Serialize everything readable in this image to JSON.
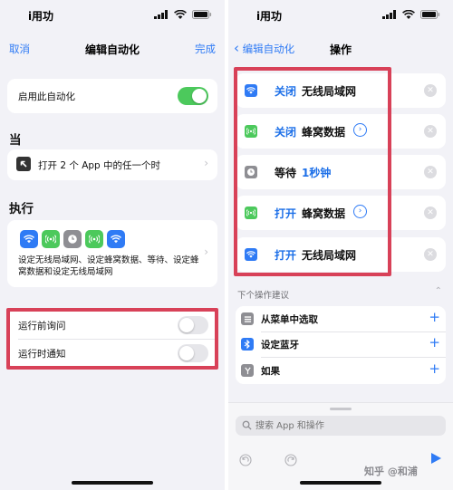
{
  "colors": {
    "accent": "#2f7bf5",
    "toggle_on": "#4cc95c",
    "highlight": "#d84158",
    "wifi_icon": "#2f7bf5",
    "cellular_icon": "#4cc95c",
    "wait_icon": "#8e8e93"
  },
  "left": {
    "status": {
      "carrier": "i用功"
    },
    "nav": {
      "cancel": "取消",
      "title": "编辑自动化",
      "done": "完成"
    },
    "enable_label": "启用此自动化",
    "enable_on": true,
    "when": {
      "title": "当",
      "trigger_text": "打开 2 个 App 中的任一个时",
      "trigger_icon": "arrow-up-left-icon"
    },
    "execute": {
      "title": "执行",
      "icons": [
        "wifi-icon",
        "cellular-icon",
        "clock-icon",
        "cellular-icon",
        "wifi-icon"
      ],
      "description": "设定无线局域网、设定蜂窝数据、等待、设定蜂窝数据和设定无线局域网"
    },
    "options": [
      {
        "label": "运行前询问",
        "on": false
      },
      {
        "label": "运行时通知",
        "on": false
      }
    ]
  },
  "right": {
    "status": {
      "carrier": "i用功"
    },
    "nav": {
      "back": "编辑自动化",
      "title": "操作"
    },
    "actions": [
      {
        "verb": "关闭",
        "noun": "无线局域网",
        "icon": "wifi-icon",
        "has_arrow": false
      },
      {
        "verb": "关闭",
        "noun": "蜂窝数据",
        "icon": "cellular-icon",
        "has_arrow": true
      },
      {
        "verb": "等待",
        "noun": "1秒钟",
        "icon": "clock-icon",
        "has_arrow": false
      },
      {
        "verb": "打开",
        "noun": "蜂窝数据",
        "icon": "cellular-icon",
        "has_arrow": true
      },
      {
        "verb": "打开",
        "noun": "无线局域网",
        "icon": "wifi-icon",
        "has_arrow": false
      }
    ],
    "suggestions": {
      "header": "下个操作建议",
      "items": [
        {
          "label": "从菜单中选取",
          "icon": "menu-list-icon"
        },
        {
          "label": "设定蓝牙",
          "icon": "bluetooth-icon"
        },
        {
          "label": "如果",
          "icon": "branch-icon"
        }
      ]
    },
    "search": {
      "placeholder": "搜索 App 和操作"
    },
    "watermark": "知乎 @和浦"
  }
}
